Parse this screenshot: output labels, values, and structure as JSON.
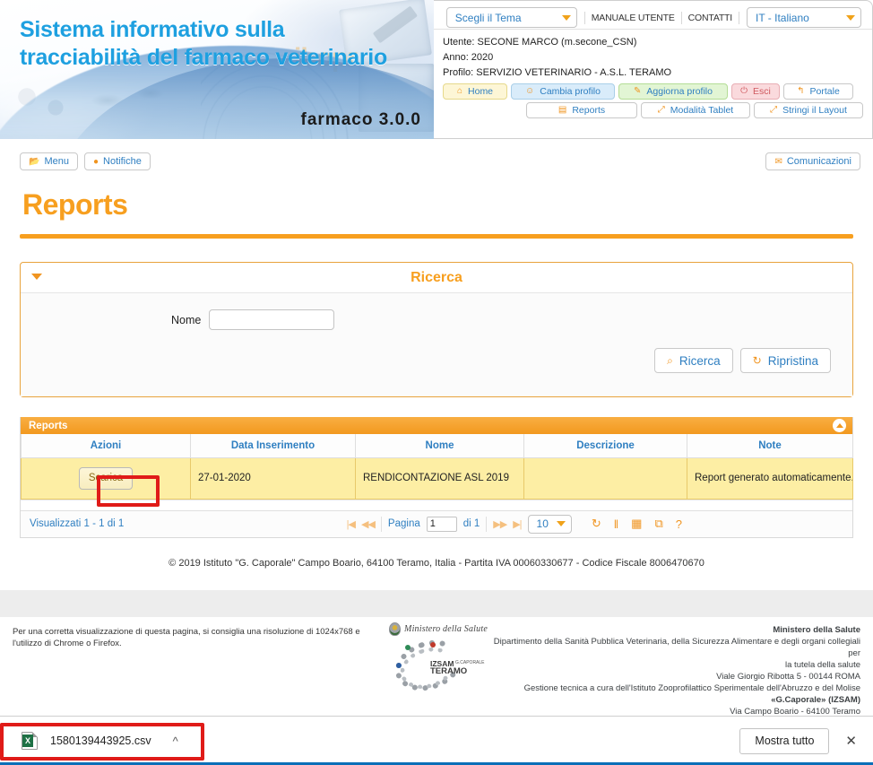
{
  "banner": {
    "title_line1": "Sistema informativo sulla",
    "title_line2": "tracciabilità del farmaco veterinario",
    "version": "farmaco 3.0.0",
    "ghost_text": "ibopr"
  },
  "header": {
    "theme_select": "Scegli il Tema",
    "manual_link": "MANUALE UTENTE",
    "contacts_link": "CONTATTI",
    "language_select": "IT - Italiano",
    "user_line": "Utente: SECONE MARCO (m.secone_CSN)",
    "year_line": "Anno: 2020",
    "profile_line": "Profilo: SERVIZIO VETERINARIO - A.S.L. TERAMO",
    "buttons_row1": [
      {
        "label": "Home",
        "icon": "home-icon",
        "style": "yellow"
      },
      {
        "label": "Cambia profilo",
        "icon": "user-icon",
        "style": "blue"
      },
      {
        "label": "Aggiorna profilo",
        "icon": "pencil-icon",
        "style": "green"
      },
      {
        "label": "Esci",
        "icon": "power-icon",
        "style": "red"
      },
      {
        "label": "Portale",
        "icon": "back-arrow-icon",
        "style": "plain"
      }
    ],
    "buttons_row2": [
      {
        "label": "Reports",
        "icon": "save-icon",
        "style": "plain"
      },
      {
        "label": "Modalità Tablet",
        "icon": "expand-icon",
        "style": "plain"
      },
      {
        "label": "Stringi il Layout",
        "icon": "expand-icon",
        "style": "plain"
      }
    ]
  },
  "toolbar": {
    "menu_label": "Menu",
    "notifiche_label": "Notifiche",
    "comunicazioni_label": "Comunicazioni"
  },
  "page": {
    "title": "Reports"
  },
  "search": {
    "panel_title": "Ricerca",
    "nome_label": "Nome",
    "nome_value": "",
    "nome_placeholder": "",
    "search_button": "Ricerca",
    "reset_button": "Ripristina"
  },
  "grid": {
    "caption": "Reports",
    "columns": [
      "Azioni",
      "Data Inserimento",
      "Nome",
      "Descrizione",
      "Note"
    ],
    "rows": [
      {
        "action_label": "Scarica",
        "data_inserimento": "27-01-2020",
        "nome": "RENDICONTAZIONE ASL 2019",
        "descrizione": "",
        "note": "Report generato automaticamente. N"
      }
    ],
    "footer": {
      "count_text": "Visualizzati 1 - 1 di 1",
      "page_label": "Pagina",
      "page_value": "1",
      "of_text": "di 1",
      "page_size": "10",
      "tools": [
        "refresh-icon",
        "pause-icon",
        "table-icon",
        "copy-icon",
        "help-icon"
      ]
    }
  },
  "footer": {
    "copyright": "© 2019 Istituto \"G. Caporale\" Campo Boario, 64100 Teramo, Italia - Partita IVA 00060330677 - Codice Fiscale 8006470670",
    "browser_note": "Per una corretta visualizzazione di questa pagina, si consiglia una risoluzione di 1024x768 e l'utilizzo di Chrome o Firefox.",
    "ministero_logo_text": "Ministero della Salute",
    "izsam_line1": "IZSAM",
    "izsam_line2": "TERAMO",
    "izsam_small": "G.CAPORALE",
    "right_block": [
      "Ministero della Salute",
      "Dipartimento della Sanità Pubblica Veterinaria, della Sicurezza Alimentare e degli organi collegiali per",
      "la tutela della salute",
      "Viale Giorgio Ribotta 5 - 00144 ROMA",
      "Gestione tecnica a cura dell'Istituto Zooprofilattico Sperimentale dell'Abruzzo e del Molise",
      "«G.Caporale» (IZSAM)",
      "Via Campo Boario - 64100 Teramo"
    ]
  },
  "download_bar": {
    "file_name": "1580139443925.csv",
    "file_icon": "excel-csv-icon",
    "expand_caret": "chevron-up-icon",
    "show_all_label": "Mostra tutto",
    "close_label": "✕"
  },
  "colors": {
    "accent_orange": "#f79f1f",
    "link_blue": "#2f7fc1",
    "row_yellow": "#fdeea4",
    "highlight_red": "#e01b18",
    "banner_blue": "#1ea0e0"
  }
}
